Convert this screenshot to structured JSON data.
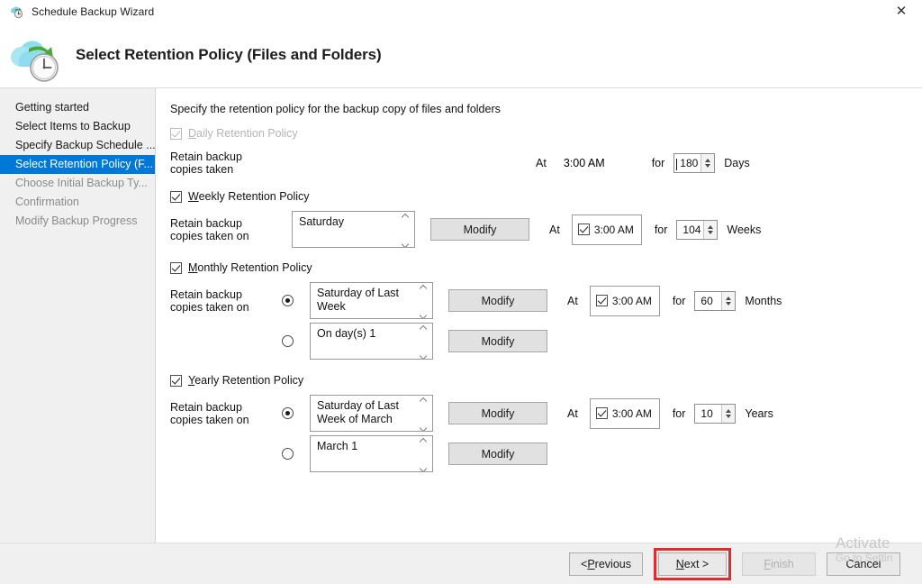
{
  "window": {
    "title": "Schedule Backup Wizard",
    "app_icon": "backup-clock-icon",
    "close_label": "✕"
  },
  "header": {
    "heading": "Select Retention Policy (Files and Folders)",
    "icon": "cloud-backup-clock-icon"
  },
  "sidebar": {
    "items": [
      {
        "label": "Getting started",
        "state": "normal"
      },
      {
        "label": "Select Items to Backup",
        "state": "normal"
      },
      {
        "label": "Specify Backup Schedule ...",
        "state": "normal"
      },
      {
        "label": "Select Retention Policy (F...",
        "state": "active"
      },
      {
        "label": "Choose Initial Backup Ty...",
        "state": "dim"
      },
      {
        "label": "Confirmation",
        "state": "dim"
      },
      {
        "label": "Modify Backup Progress",
        "state": "dim"
      }
    ]
  },
  "content": {
    "intro": "Specify the retention policy for the backup copy of files and folders",
    "at_label": "At",
    "for_label": "for",
    "modify_label": "Modify",
    "retain_taken_label": "Retain backup copies taken",
    "retain_taken_on_label": "Retain backup copies taken on",
    "daily": {
      "title_prefix": "D",
      "title_rest": "aily Retention Policy",
      "checked": true,
      "enabled": false,
      "time": "3:00 AM",
      "duration": "180",
      "unit": "Days"
    },
    "weekly": {
      "title_prefix": "W",
      "title_rest": "eekly Retention Policy",
      "checked": true,
      "day": "Saturday",
      "time": "3:00 AM",
      "time_checked": true,
      "duration": "104",
      "unit": "Weeks"
    },
    "monthly": {
      "title_prefix": "M",
      "title_rest": "onthly Retention Policy",
      "checked": true,
      "option_a": "Saturday of Last Week",
      "option_a_selected": true,
      "option_b": "On day(s) 1",
      "option_b_selected": false,
      "time": "3:00 AM",
      "time_checked": true,
      "duration": "60",
      "unit": "Months"
    },
    "yearly": {
      "title_prefix": "Y",
      "title_rest": "early Retention Policy",
      "checked": true,
      "option_a": "Saturday of Last Week of March",
      "option_a_selected": true,
      "option_b": "March 1",
      "option_b_selected": false,
      "time": "3:00 AM",
      "time_checked": true,
      "duration": "10",
      "unit": "Years"
    }
  },
  "footer": {
    "previous_prefix": "< ",
    "previous_u": "P",
    "previous_rest": "revious",
    "next_u": "N",
    "next_rest": "ext >",
    "finish_u": "F",
    "finish_rest": "inish",
    "finish_disabled": true,
    "cancel_label": "Cancel"
  },
  "watermark": {
    "line1": "Activate",
    "line2": "Go to Settin"
  },
  "colors": {
    "accent": "#0078d7",
    "header_accent": "#16548c",
    "highlight_box": "#e02c2c"
  }
}
